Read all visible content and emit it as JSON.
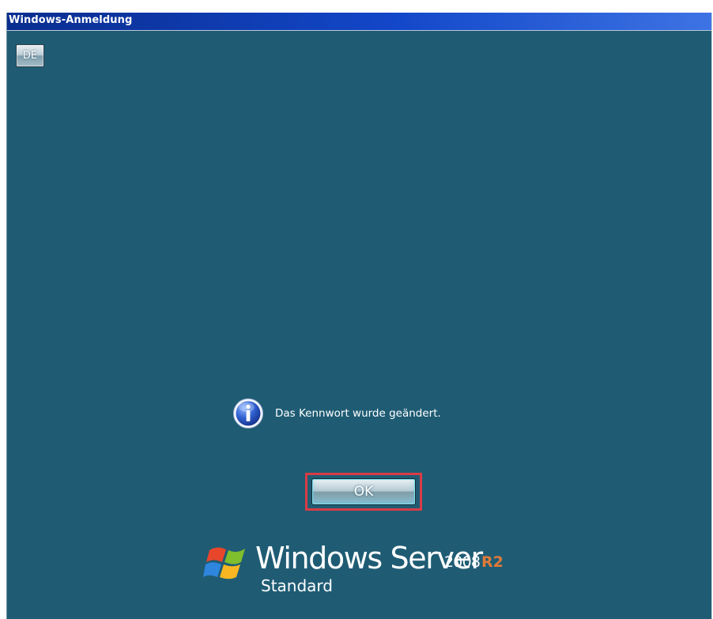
{
  "window": {
    "title": "Windows-Anmeldung"
  },
  "language_button": {
    "label": "DE"
  },
  "message": {
    "icon": "info-icon",
    "text": "Das Kennwort wurde geändert."
  },
  "ok_button": {
    "label": "OK"
  },
  "branding": {
    "logo": "windows-flag-icon",
    "product": "Windows Server",
    "version": "2008",
    "release": "R2",
    "edition": "Standard"
  },
  "colors": {
    "background": "#1f5c74",
    "titlebar": "#0a2d8f",
    "highlight": "#d83c46",
    "r2_accent": "#e07a38"
  }
}
